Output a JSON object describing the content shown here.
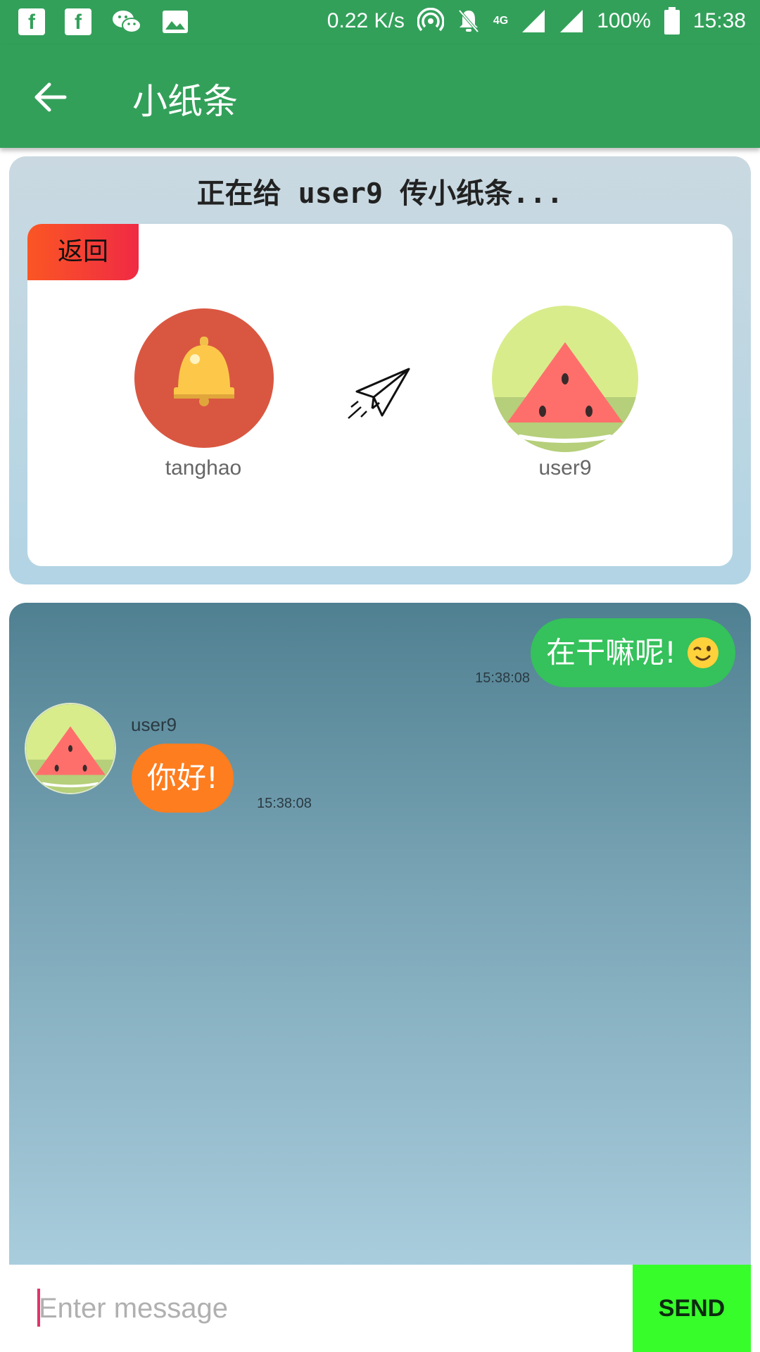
{
  "status_bar": {
    "network_speed": "0.22 K/s",
    "network_type": "4G",
    "battery": "100%",
    "time": "15:38"
  },
  "app_bar": {
    "title": "小纸条"
  },
  "info_card": {
    "title": "正在给 user9 传小纸条...",
    "back_label": "返回",
    "sender_name": "tanghao",
    "receiver_name": "user9"
  },
  "chat": {
    "messages": [
      {
        "direction": "outgoing",
        "text": "在干嘛呢!",
        "emoji": "wink-emoji",
        "time": "15:38:08"
      },
      {
        "direction": "incoming",
        "sender": "user9",
        "text": "你好!",
        "time": "15:38:08"
      }
    ]
  },
  "composer": {
    "placeholder": "Enter message",
    "send_label": "SEND"
  },
  "colors": {
    "primary": "#33a05a",
    "outgoing_bubble": "#35c15b",
    "incoming_bubble": "#fe7d1f",
    "send_button": "#37fd2a",
    "back_button_start": "#fb5624",
    "back_button_end": "#f02a44"
  }
}
